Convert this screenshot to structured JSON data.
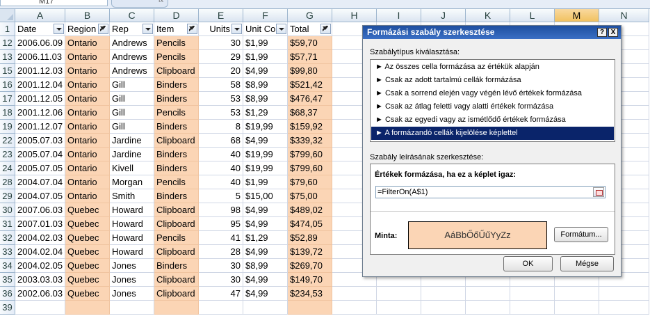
{
  "formula_bar": {
    "name_box": "M17",
    "fx": "fx"
  },
  "columns": [
    "A",
    "B",
    "C",
    "D",
    "E",
    "F",
    "G",
    "H",
    "I",
    "J",
    "K",
    "L",
    "M",
    "N"
  ],
  "selected_column": "M",
  "header_row": {
    "row": "1",
    "cells": [
      "Date",
      "Region",
      "Rep",
      "Item",
      "Units",
      "Unit Co",
      "Total"
    ]
  },
  "rows": [
    {
      "row": "12",
      "cells": [
        "2006.06.09",
        "Ontario",
        "Andrews",
        "Pencils",
        "30",
        "$1,99",
        "$59,70"
      ]
    },
    {
      "row": "13",
      "cells": [
        "2006.11.03",
        "Ontario",
        "Andrews",
        "Pencils",
        "29",
        "$1,99",
        "$57,71"
      ]
    },
    {
      "row": "15",
      "cells": [
        "2001.12.03",
        "Ontario",
        "Andrews",
        "Clipboard",
        "20",
        "$4,99",
        "$99,80"
      ]
    },
    {
      "row": "16",
      "cells": [
        "2001.12.04",
        "Ontario",
        "Gill",
        "Binders",
        "58",
        "$8,99",
        "$521,42"
      ]
    },
    {
      "row": "17",
      "cells": [
        "2001.12.05",
        "Ontario",
        "Gill",
        "Binders",
        "53",
        "$8,99",
        "$476,47"
      ]
    },
    {
      "row": "18",
      "cells": [
        "2001.12.06",
        "Ontario",
        "Gill",
        "Pencils",
        "53",
        "$1,29",
        "$68,37"
      ]
    },
    {
      "row": "19",
      "cells": [
        "2001.12.07",
        "Ontario",
        "Gill",
        "Binders",
        "8",
        "$19,99",
        "$159,92"
      ]
    },
    {
      "row": "22",
      "cells": [
        "2005.07.03",
        "Ontario",
        "Jardine",
        "Clipboard",
        "68",
        "$4,99",
        "$339,32"
      ]
    },
    {
      "row": "23",
      "cells": [
        "2005.07.04",
        "Ontario",
        "Jardine",
        "Binders",
        "40",
        "$19,99",
        "$799,60"
      ]
    },
    {
      "row": "24",
      "cells": [
        "2005.07.05",
        "Ontario",
        "Kivell",
        "Binders",
        "40",
        "$19,99",
        "$799,60"
      ]
    },
    {
      "row": "28",
      "cells": [
        "2004.07.04",
        "Ontario",
        "Morgan",
        "Pencils",
        "40",
        "$1,99",
        "$79,60"
      ]
    },
    {
      "row": "29",
      "cells": [
        "2004.07.05",
        "Ontario",
        "Smith",
        "Binders",
        "5",
        "$15,00",
        "$75,00"
      ]
    },
    {
      "row": "30",
      "cells": [
        "2007.06.03",
        "Quebec",
        "Howard",
        "Clipboard",
        "98",
        "$4,99",
        "$489,02"
      ]
    },
    {
      "row": "31",
      "cells": [
        "2007.01.03",
        "Quebec",
        "Howard",
        "Clipboard",
        "95",
        "$4,99",
        "$474,05"
      ]
    },
    {
      "row": "32",
      "cells": [
        "2004.02.03",
        "Quebec",
        "Howard",
        "Pencils",
        "41",
        "$1,29",
        "$52,89"
      ]
    },
    {
      "row": "33",
      "cells": [
        "2004.02.04",
        "Quebec",
        "Howard",
        "Clipboard",
        "28",
        "$4,99",
        "$139,72"
      ]
    },
    {
      "row": "34",
      "cells": [
        "2004.02.05",
        "Quebec",
        "Jones",
        "Binders",
        "30",
        "$8,99",
        "$269,70"
      ]
    },
    {
      "row": "35",
      "cells": [
        "2003.03.03",
        "Quebec",
        "Jones",
        "Clipboard",
        "30",
        "$4,99",
        "$149,70"
      ]
    },
    {
      "row": "36",
      "cells": [
        "2002.06.03",
        "Quebec",
        "Jones",
        "Clipboard",
        "47",
        "$4,99",
        "$234,53"
      ]
    },
    {
      "row": "39",
      "cells": [
        "",
        "",
        "",
        "",
        "",
        "",
        ""
      ]
    }
  ],
  "highlight_color": "#fbd5b5",
  "dialog": {
    "title": "Formázási szabály szerkesztése",
    "help_btn": "?",
    "close_btn": "X",
    "type_label": "Szabálytípus kiválasztása:",
    "rule_types": [
      "► Az összes cella formázása az értékük alapján",
      "► Csak az adott tartalmú cellák formázása",
      "► Csak a sorrend elején vagy végén lévő értékek formázása",
      "► Csak az átlag feletti vagy alatti értékek formázása",
      "► Csak az egyedi vagy az ismétlődő értékek formázása",
      "► A formázandó cellák kijelölése képlettel"
    ],
    "selected_rule_index": 5,
    "desc_label": "Szabály leírásának szerkesztése:",
    "formula_label": "Értékek formázása, ha ez a képlet igaz:",
    "formula_value": "=FilterOn(A$1)",
    "preview_label": "Minta:",
    "preview_text": "AáBbŐőŰűYyZz",
    "format_button": "Formátum...",
    "ok_button": "OK",
    "cancel_button": "Mégse",
    "title_color": "#1e4fa0",
    "selection_color": "#0a246a"
  }
}
